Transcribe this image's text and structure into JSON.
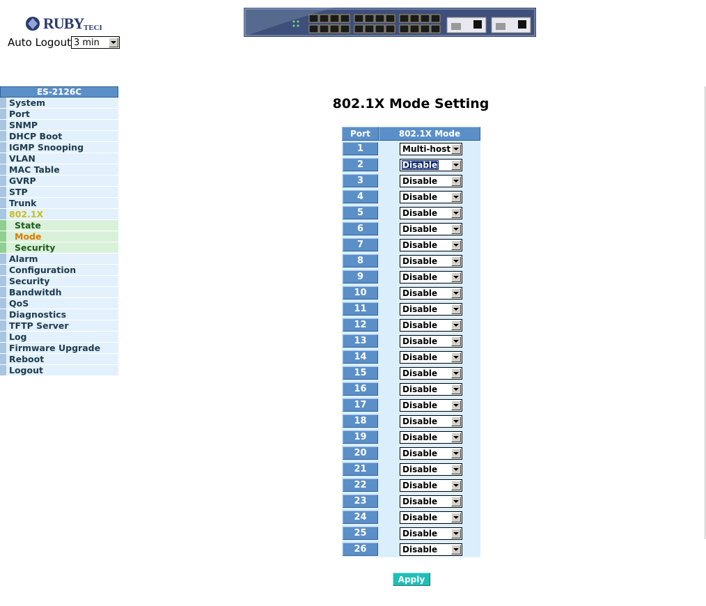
{
  "header": {
    "brand_logo": "RUBYTECH",
    "auto_logout_label": "Auto Logout",
    "auto_logout_value": "3 min"
  },
  "sidebar": {
    "title": "ES-2126C",
    "items": [
      {
        "label": "System"
      },
      {
        "label": "Port"
      },
      {
        "label": "SNMP"
      },
      {
        "label": "DHCP Boot"
      },
      {
        "label": "IGMP Snooping"
      },
      {
        "label": "VLAN"
      },
      {
        "label": "MAC Table"
      },
      {
        "label": "GVRP"
      },
      {
        "label": "STP"
      },
      {
        "label": "Trunk"
      },
      {
        "label": "802.1X",
        "active": true
      },
      {
        "label": "State",
        "sub": true
      },
      {
        "label": "Mode",
        "sub": true,
        "current": true
      },
      {
        "label": "Security",
        "sub": true
      },
      {
        "label": "Alarm"
      },
      {
        "label": "Configuration"
      },
      {
        "label": "Security"
      },
      {
        "label": "Bandwitdh"
      },
      {
        "label": "QoS"
      },
      {
        "label": "Diagnostics"
      },
      {
        "label": "TFTP Server"
      },
      {
        "label": "Log"
      },
      {
        "label": "Firmware Upgrade"
      },
      {
        "label": "Reboot"
      },
      {
        "label": "Logout"
      }
    ]
  },
  "main": {
    "title": "802.1X Mode Setting",
    "columns": [
      "Port",
      "802.1X Mode"
    ],
    "rows": [
      {
        "port": "1",
        "mode": "Multi-host"
      },
      {
        "port": "2",
        "mode": "Disable",
        "focused": true
      },
      {
        "port": "3",
        "mode": "Disable"
      },
      {
        "port": "4",
        "mode": "Disable"
      },
      {
        "port": "5",
        "mode": "Disable"
      },
      {
        "port": "6",
        "mode": "Disable"
      },
      {
        "port": "7",
        "mode": "Disable"
      },
      {
        "port": "8",
        "mode": "Disable"
      },
      {
        "port": "9",
        "mode": "Disable"
      },
      {
        "port": "10",
        "mode": "Disable"
      },
      {
        "port": "11",
        "mode": "Disable"
      },
      {
        "port": "12",
        "mode": "Disable"
      },
      {
        "port": "13",
        "mode": "Disable"
      },
      {
        "port": "14",
        "mode": "Disable"
      },
      {
        "port": "15",
        "mode": "Disable"
      },
      {
        "port": "16",
        "mode": "Disable"
      },
      {
        "port": "17",
        "mode": "Disable"
      },
      {
        "port": "18",
        "mode": "Disable"
      },
      {
        "port": "19",
        "mode": "Disable"
      },
      {
        "port": "20",
        "mode": "Disable"
      },
      {
        "port": "21",
        "mode": "Disable"
      },
      {
        "port": "22",
        "mode": "Disable"
      },
      {
        "port": "23",
        "mode": "Disable"
      },
      {
        "port": "24",
        "mode": "Disable"
      },
      {
        "port": "25",
        "mode": "Disable"
      },
      {
        "port": "26",
        "mode": "Disable"
      }
    ],
    "apply_label": "Apply"
  },
  "colors": {
    "header_blue": "#5b8fc8",
    "nav_bg": "#e2f1fc",
    "sub_nav_bg": "#d9f1d9",
    "active_menu": "#c9bf1c",
    "current_sub": "#e07800",
    "apply_button": "#1fbfb8"
  }
}
